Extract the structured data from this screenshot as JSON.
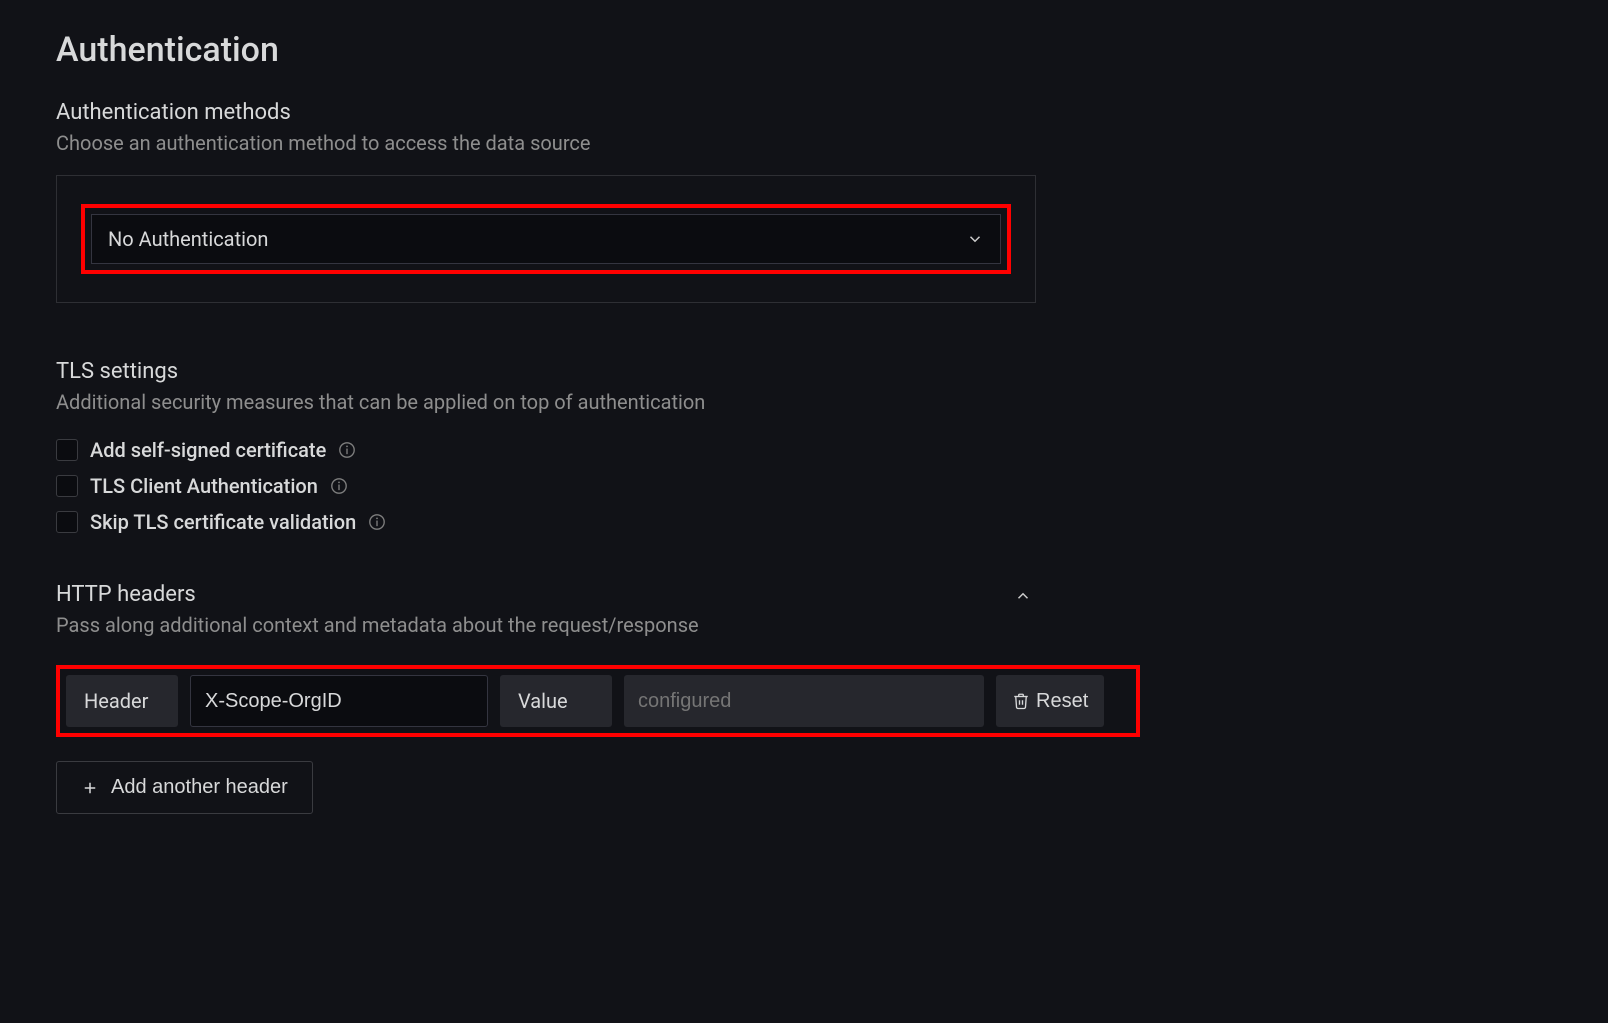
{
  "title": "Authentication",
  "auth_methods": {
    "heading": "Authentication methods",
    "description": "Choose an authentication method to access the data source",
    "selected": "No Authentication"
  },
  "tls": {
    "heading": "TLS settings",
    "description": "Additional security measures that can be applied on top of authentication",
    "options": [
      {
        "label": "Add self-signed certificate"
      },
      {
        "label": "TLS Client Authentication"
      },
      {
        "label": "Skip TLS certificate validation"
      }
    ]
  },
  "http_headers": {
    "heading": "HTTP headers",
    "description": "Pass along additional context and metadata about the request/response",
    "header_label": "Header",
    "value_label": "Value",
    "rows": [
      {
        "name": "X-Scope-OrgID",
        "value_placeholder": "configured"
      }
    ],
    "reset_label": "Reset",
    "add_label": "Add another header"
  }
}
